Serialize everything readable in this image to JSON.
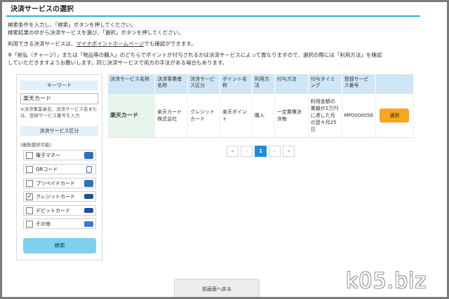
{
  "page": {
    "title": "決済サービスの選択",
    "intro_line1": "検索条件を入力し、「検索」ボタンを押してください。",
    "intro_line2": "検索結果の中から決済サービスを選び、「選択」ボタンを押してください。",
    "intro_line3_prefix": "利用できる決済サービスは、",
    "intro_line3_link": "マイナポイントホームページ",
    "intro_line3_suffix": "でも確認ができます。",
    "intro_line4": "※「前払（チャージ）」または「物品等の購入」のどちらでポイントが付与されるかは決済サービスによって異なりますので、選択の際には「利用方法」を確認",
    "intro_line5": "していただきますようお願いします。同じ決済サービスで両方の手法がある場合もあります。"
  },
  "sidebar": {
    "keyword_header": "キーワード",
    "keyword_value": "楽天カード",
    "keyword_hint": "※決済事業者名、決済サービス名または、登録サービス番号を入力",
    "service_header": "決済サービス区分",
    "multi_note": "(複数選択可能)",
    "services": [
      {
        "label": "電子マネー",
        "checked": false,
        "icon": "emoney-icon"
      },
      {
        "label": "QRコード",
        "checked": false,
        "icon": "smartphone-icon"
      },
      {
        "label": "プリペイドカード",
        "checked": false,
        "icon": "prepaid-card-icon"
      },
      {
        "label": "クレジットカード",
        "checked": true,
        "icon": "credit-card-icon"
      },
      {
        "label": "デビットカード",
        "checked": false,
        "icon": "debit-card-icon"
      },
      {
        "label": "その他",
        "checked": false,
        "icon": "other-card-icon"
      }
    ],
    "search_button": "検索"
  },
  "table": {
    "headers": [
      "決済サービス名称",
      "決済事業者名称",
      "決済サービス区分",
      "ポイント名称",
      "利用方法",
      "付与方法",
      "付与タイミング",
      "登録サービス番号",
      ""
    ],
    "rows": [
      {
        "service_name": "楽天カード",
        "company": "楽天カード株式会社",
        "category": "クレジットカード",
        "point_name": "楽天ポイント",
        "usage": "購入",
        "grant_method": "一定業積決済毎",
        "grant_timing": "利用金額の業績が2万円に達した月の翌々月25日",
        "service_number": "MP0000056",
        "select_label": "選択"
      }
    ]
  },
  "pager": {
    "first": "«",
    "prev": "‹",
    "current": "1",
    "next": "›",
    "last": "»"
  },
  "back_button": "前画面へ戻る",
  "watermark": "k05.biz"
}
